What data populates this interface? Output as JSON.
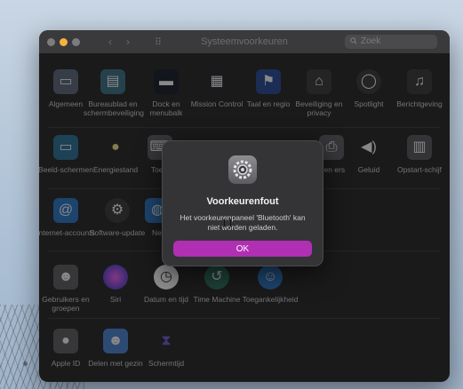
{
  "window": {
    "title": "Systeemvoorkeuren",
    "search_placeholder": "Zoek",
    "nav_back": "‹",
    "nav_forward": "›",
    "grid_icon": "⠿"
  },
  "panes": [
    {
      "id": "algemeen",
      "label": "Algemeen",
      "icon": "general-icon"
    },
    {
      "id": "bureaublad",
      "label": "Bureaublad en schermbeveiliging",
      "icon": "desktop-icon"
    },
    {
      "id": "dock",
      "label": "Dock en menubalk",
      "icon": "dock-icon"
    },
    {
      "id": "mission",
      "label": "Mission Control",
      "icon": "mission-control-icon"
    },
    {
      "id": "taal",
      "label": "Taal en regio",
      "icon": "flag-icon"
    },
    {
      "id": "beveiliging",
      "label": "Beveiliging en privacy",
      "icon": "house-icon"
    },
    {
      "id": "spotlight",
      "label": "Spotlight",
      "icon": "spotlight-icon"
    },
    {
      "id": "berichtgeving",
      "label": "Berichtgeving",
      "icon": "bell-icon"
    },
    {
      "id": "beeldschermen",
      "label": "Beeld-schermen",
      "icon": "display-icon"
    },
    {
      "id": "energiestand",
      "label": "Energiestand",
      "icon": "bulb-icon"
    },
    {
      "id": "toetsenbord",
      "label": "Toets",
      "icon": "keyboard-icon"
    },
    {
      "id": "printers",
      "label": "s en ers",
      "icon": "printer-icon"
    },
    {
      "id": "geluid",
      "label": "Geluid",
      "icon": "speaker-icon"
    },
    {
      "id": "opstartschijf",
      "label": "Opstart-schijf",
      "icon": "disk-icon"
    },
    {
      "id": "internet",
      "label": "Internet-accounts",
      "icon": "at-icon"
    },
    {
      "id": "softwareupdate",
      "label": "Software-update",
      "icon": "software-update-icon"
    },
    {
      "id": "netwerk",
      "label": "Ne",
      "icon": "network-icon"
    },
    {
      "id": "gebruikers",
      "label": "Gebruikers en groepen",
      "icon": "users-icon"
    },
    {
      "id": "siri",
      "label": "Siri",
      "icon": "siri-icon"
    },
    {
      "id": "datum",
      "label": "Datum en tijd",
      "icon": "clock-icon"
    },
    {
      "id": "timemachine",
      "label": "Time Machine",
      "icon": "time-machine-icon"
    },
    {
      "id": "toegankelijkheid",
      "label": "Toegankelijkheid",
      "icon": "accessibility-icon"
    },
    {
      "id": "appleid",
      "label": "Apple ID",
      "icon": "apple-icon"
    },
    {
      "id": "delen",
      "label": "Delen met gezin",
      "icon": "family-icon"
    },
    {
      "id": "schermtijd",
      "label": "Schermtijd",
      "icon": "hourglass-icon"
    }
  ],
  "dialog": {
    "title": "Voorkeurenfout",
    "message": "Het voorkeurenpaneel 'Bluetooth' kan niet worden geladen.",
    "ok_label": "OK",
    "accent_color": "#b02fb3",
    "icon": "system-preferences-gear-icon"
  }
}
